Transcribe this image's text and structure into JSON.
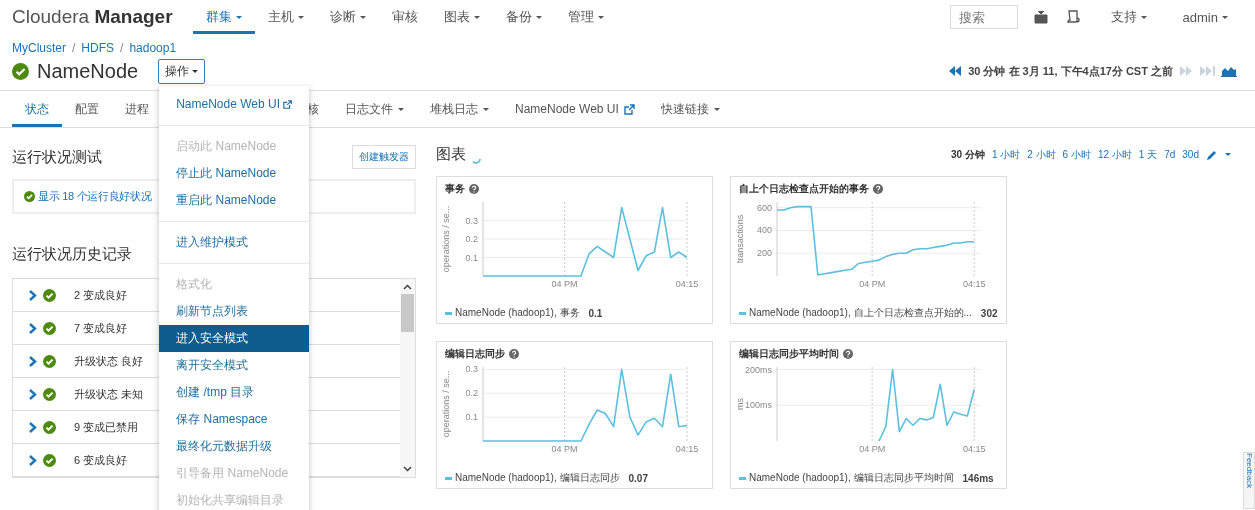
{
  "app": {
    "logo": "Cloudera **Manager**"
  },
  "top_nav": [
    {
      "label": "群集",
      "selected": true,
      "dropdown": true
    },
    {
      "label": "主机",
      "selected": false,
      "dropdown": true
    },
    {
      "label": "诊断",
      "selected": false,
      "dropdown": true
    },
    {
      "label": "审核",
      "selected": false,
      "dropdown": false
    },
    {
      "label": "图表",
      "selected": false,
      "dropdown": true
    },
    {
      "label": "备份",
      "selected": false,
      "dropdown": true
    },
    {
      "label": "管理",
      "selected": false,
      "dropdown": true
    }
  ],
  "search": {
    "placeholder": "搜索"
  },
  "user_menu": [
    {
      "label": "支持"
    },
    {
      "label": "admin"
    }
  ],
  "breadcrumb": [
    {
      "kind": "link",
      "text": "MyCluster"
    },
    {
      "kind": "separator",
      "text": "/"
    },
    {
      "kind": "link",
      "text": "HDFS"
    },
    {
      "kind": "separator",
      "text": "/"
    },
    {
      "kind": "link",
      "text": "hadoop1"
    }
  ],
  "page": {
    "title": "NameNode",
    "healthy": true,
    "actions_button": "操作"
  },
  "time_nav": {
    "text": "30 分钟 在 3月 11, 下午4点17分 CST 之前"
  },
  "tabs": [
    {
      "label": "状态",
      "kind": "plain",
      "selected": true
    },
    {
      "label": "配置",
      "kind": "plain",
      "selected": false
    },
    {
      "label": "进程",
      "kind": "plain",
      "selected": false
    },
    {
      "label": "核",
      "kind": "covered",
      "selected": false
    },
    {
      "label": "日志文件",
      "kind": "dropdown",
      "selected": false
    },
    {
      "label": "堆栈日志",
      "kind": "dropdown",
      "selected": false
    },
    {
      "label": "NameNode Web UI",
      "kind": "external",
      "selected": false
    },
    {
      "label": "快速链接",
      "kind": "dropdown",
      "selected": false
    }
  ],
  "health_tests": {
    "title": "运行状况测试",
    "trigger_button": "创建触发器",
    "summary": "显示 18 个运行良好状况"
  },
  "health_history": {
    "title": "运行状况历史记录",
    "rows": [
      {
        "text": "2 变成良好"
      },
      {
        "text": "7 变成良好"
      },
      {
        "text": "升级状态 良好"
      },
      {
        "text": "升级状态 未知"
      },
      {
        "text": "9 变成已禁用"
      },
      {
        "text": "6 变成良好"
      }
    ]
  },
  "actions_menu": {
    "items": [
      {
        "kind": "external",
        "label": "NameNode Web UI",
        "disabled": false,
        "selected": false
      },
      {
        "kind": "divider"
      },
      {
        "kind": "action",
        "label": "启动此 NameNode",
        "disabled": true,
        "selected": false
      },
      {
        "kind": "action",
        "label": "停止此 NameNode",
        "disabled": false,
        "selected": false
      },
      {
        "kind": "action",
        "label": "重启此 NameNode",
        "disabled": false,
        "selected": false
      },
      {
        "kind": "divider"
      },
      {
        "kind": "action",
        "label": "进入维护模式",
        "disabled": false,
        "selected": false
      },
      {
        "kind": "divider"
      },
      {
        "kind": "action",
        "label": "格式化",
        "disabled": true,
        "selected": false
      },
      {
        "kind": "action",
        "label": "刷新节点列表",
        "disabled": false,
        "selected": false
      },
      {
        "kind": "action",
        "label": "进入安全模式",
        "disabled": false,
        "selected": true
      },
      {
        "kind": "action",
        "label": "离开安全模式",
        "disabled": false,
        "selected": false
      },
      {
        "kind": "action",
        "label": "创建 /tmp 目录",
        "disabled": false,
        "selected": false
      },
      {
        "kind": "action",
        "label": "保存 Namespace",
        "disabled": false,
        "selected": false
      },
      {
        "kind": "action",
        "label": "最终化元数据升级",
        "disabled": false,
        "selected": false
      },
      {
        "kind": "action",
        "label": "引导备用 NameNode",
        "disabled": true,
        "selected": false
      },
      {
        "kind": "action",
        "label": "初始化共享编辑目录",
        "disabled": true,
        "selected": false
      }
    ]
  },
  "charts_panel": {
    "title": "图表",
    "ranges": [
      {
        "label": "30 分钟",
        "selected": true
      },
      {
        "label": "1 小时",
        "selected": false
      },
      {
        "label": "2 小时",
        "selected": false
      },
      {
        "label": "6 小时",
        "selected": false
      },
      {
        "label": "12 小时",
        "selected": false
      },
      {
        "label": "1 天",
        "selected": false
      },
      {
        "label": "7d",
        "selected": false
      },
      {
        "label": "30d",
        "selected": false
      }
    ],
    "charts": [
      {
        "title": "事务",
        "legend_value": "0.1",
        "chart_data": {
          "type": "line",
          "grid": true,
          "ylabel": "operations / se...",
          "ylim": [
            0,
            0.4
          ],
          "yticks": [
            0.1,
            0.2,
            0.3
          ],
          "categories": [
            null,
            null,
            null,
            null,
            null,
            null,
            null,
            null,
            null,
            null,
            "04 PM",
            null,
            null,
            null,
            null,
            null,
            null,
            null,
            null,
            null,
            null,
            null,
            null,
            null,
            null,
            "04:15"
          ],
          "series": [
            {
              "name": "NameNode (hadoop1), 事务",
              "color": "#5bc0de",
              "values": [
                0,
                0,
                0,
                0,
                0,
                0,
                0,
                0,
                0,
                0,
                0,
                0,
                0,
                0.12,
                0.16,
                0.13,
                0.1,
                0.37,
                0.2,
                0.03,
                0.11,
                0.13,
                0.37,
                0.1,
                0.13,
                0.1
              ]
            }
          ]
        }
      },
      {
        "title": "自上个日志检查点开始的事务",
        "legend_value": "302",
        "chart_data": {
          "type": "line",
          "grid": true,
          "ylabel": "transactions",
          "ylim": [
            0,
            650
          ],
          "yticks": [
            200,
            400,
            600
          ],
          "categories": [
            null,
            null,
            null,
            null,
            null,
            null,
            null,
            null,
            null,
            null,
            null,
            null,
            null,
            null,
            "04 PM",
            null,
            null,
            null,
            null,
            null,
            null,
            null,
            null,
            null,
            null,
            null,
            null,
            null,
            null,
            "04:15",
            null
          ],
          "series": [
            {
              "name": "NameNode (hadoop1), 自上个日志检查点开始的...",
              "color": "#5bc0de",
              "values": [
                580,
                580,
                600,
                610,
                610,
                610,
                10,
                20,
                30,
                40,
                50,
                60,
                110,
                120,
                130,
                140,
                170,
                190,
                200,
                200,
                230,
                240,
                240,
                250,
                260,
                270,
                290,
                290,
                300,
                300,
                null
              ]
            }
          ]
        }
      },
      {
        "title": "编辑日志同步",
        "legend_value": "0.07",
        "chart_data": {
          "type": "line",
          "grid": true,
          "ylabel": "operations / se...",
          "ylim": [
            0,
            0.31
          ],
          "yticks": [
            0.1,
            0.2,
            0.3
          ],
          "categories": [
            null,
            null,
            null,
            null,
            null,
            null,
            null,
            null,
            null,
            null,
            "04 PM",
            null,
            null,
            null,
            null,
            null,
            null,
            null,
            null,
            null,
            null,
            null,
            null,
            null,
            null,
            "04:15"
          ],
          "series": [
            {
              "name": "NameNode (hadoop1), 编辑日志同步",
              "color": "#5bc0de",
              "values": [
                0,
                0,
                0,
                0,
                0,
                0,
                0,
                0,
                0,
                0,
                0,
                0,
                0,
                0.07,
                0.13,
                0.115,
                0.06,
                0.3,
                0.1,
                0.025,
                0.08,
                0.095,
                0.06,
                0.28,
                0.06,
                0.065
              ]
            }
          ]
        }
      },
      {
        "title": "编辑日志同步平均时间",
        "legend_value": "146ms",
        "chart_data": {
          "type": "line",
          "grid": true,
          "ylabel": "ms",
          "ylim": [
            0,
            207
          ],
          "yticks": [
            {
              "value": 100,
              "label": "100ms"
            },
            {
              "value": 200,
              "label": "200ms"
            }
          ],
          "categories": [
            null,
            null,
            null,
            null,
            null,
            null,
            null,
            null,
            null,
            null,
            null,
            null,
            null,
            null,
            "04 PM",
            null,
            null,
            null,
            null,
            null,
            null,
            null,
            null,
            null,
            null,
            null,
            null,
            null,
            null,
            "04:15",
            null
          ],
          "series": [
            {
              "name": "NameNode (hadoop1), 编辑日志同步平均时间",
              "color": "#5bc0de",
              "values": [
                null,
                null,
                null,
                null,
                null,
                null,
                null,
                null,
                null,
                null,
                null,
                null,
                null,
                null,
                null,
                0,
                40,
                200,
                26,
                63,
                44,
                63,
                59,
                66,
                159,
                44,
                81,
                75,
                70,
                144,
                null
              ]
            }
          ]
        }
      }
    ]
  },
  "feedback": {
    "label": "Feedback"
  }
}
